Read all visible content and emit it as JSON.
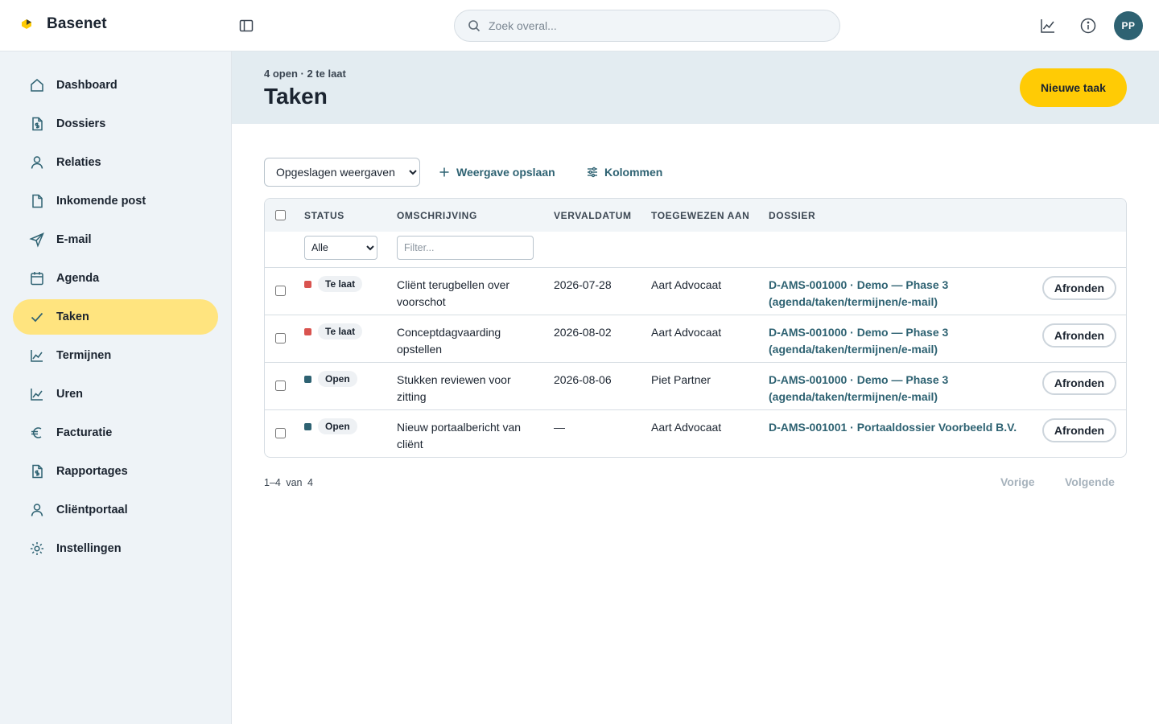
{
  "brand": {
    "name": "Basenet"
  },
  "search": {
    "placeholder": "Zoek overal..."
  },
  "user": {
    "initials": "PP"
  },
  "sidebar": {
    "items": [
      {
        "label": "Dashboard",
        "icon": "home-icon"
      },
      {
        "label": "Dossiers",
        "icon": "file-dollar-icon"
      },
      {
        "label": "Relaties",
        "icon": "person-icon"
      },
      {
        "label": "Inkomende post",
        "icon": "file-icon"
      },
      {
        "label": "E-mail",
        "icon": "send-icon"
      },
      {
        "label": "Agenda",
        "icon": "calendar-icon"
      },
      {
        "label": "Taken",
        "icon": "check-icon",
        "active": true
      },
      {
        "label": "Termijnen",
        "icon": "chart-line-icon"
      },
      {
        "label": "Uren",
        "icon": "chart-line-icon"
      },
      {
        "label": "Facturatie",
        "icon": "euro-icon"
      },
      {
        "label": "Rapportages",
        "icon": "file-dollar-icon"
      },
      {
        "label": "Cliëntportaal",
        "icon": "person-icon"
      },
      {
        "label": "Instellingen",
        "icon": "gear-icon"
      }
    ]
  },
  "header": {
    "subtitle": "4 open · 2 te laat",
    "title": "Taken",
    "new_button": "Nieuwe taak"
  },
  "toolbar": {
    "views_select": "Opgeslagen weergaven",
    "save_view": "Weergave opslaan",
    "columns": "Kolommen"
  },
  "table": {
    "columns": [
      "STATUS",
      "OMSCHRIJVING",
      "VERVALDATUM",
      "TOEGEWEZEN AAN",
      "DOSSIER"
    ],
    "status_filter": "Alle",
    "text_filter_placeholder": "Filter...",
    "action_label": "Afronden",
    "rows": [
      {
        "status": "Te laat",
        "status_color": "#d9534f",
        "description": "Cliënt terugbellen over voorschot",
        "due": "2026-07-28",
        "assignee": "Aart Advocaat",
        "dossier": "D-AMS-001000 · Demo — Phase 3 (agenda/taken/termijnen/e-mail)"
      },
      {
        "status": "Te laat",
        "status_color": "#d9534f",
        "description": "Conceptdagvaarding opstellen",
        "due": "2026-08-02",
        "assignee": "Aart Advocaat",
        "dossier": "D-AMS-001000 · Demo — Phase 3 (agenda/taken/termijnen/e-mail)"
      },
      {
        "status": "Open",
        "status_color": "#2e6272",
        "description": "Stukken reviewen voor zitting",
        "due": "2026-08-06",
        "assignee": "Piet Partner",
        "dossier": "D-AMS-001000 · Demo — Phase 3 (agenda/taken/termijnen/e-mail)"
      },
      {
        "status": "Open",
        "status_color": "#2e6272",
        "description": "Nieuw portaalbericht van cliënt",
        "due": "—",
        "assignee": "Aart Advocaat",
        "dossier": "D-AMS-001001 · Portaaldossier Voorbeeld B.V."
      }
    ]
  },
  "pagination": {
    "range": "1–4 van 4",
    "prev": "Vorige",
    "next": "Volgende"
  },
  "colors": {
    "accent": "#ffcb05",
    "active_nav": "#ffe47f",
    "link": "#2e6272",
    "overdue": "#d9534f"
  }
}
